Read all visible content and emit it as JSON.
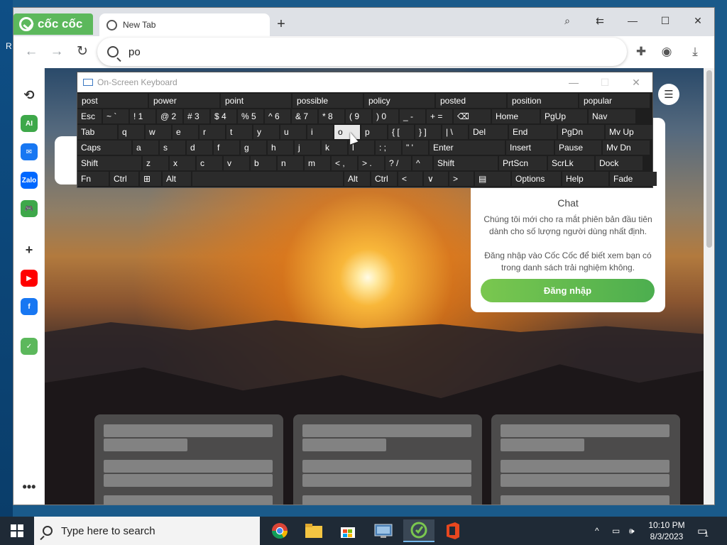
{
  "desktop": {
    "edge_text": "R"
  },
  "browser": {
    "brand": "cốc cốc",
    "tab_title": "New Tab",
    "new_tab": "+",
    "window_controls": {
      "minimize": "—",
      "maximize": "☐",
      "close": "✕"
    },
    "extra_controls": {
      "screenshot": "⌕",
      "sidebar_toggle": "⇇"
    },
    "nav": {
      "back": "←",
      "forward": "→",
      "reload": "↻"
    },
    "omnibox_value": "po",
    "toolbar_icons": {
      "extensions": "✚",
      "profile": "◉",
      "download": "⤓"
    }
  },
  "sidebar": [
    {
      "name": "history-icon",
      "glyph": "⟲",
      "color": "#333333"
    },
    {
      "name": "ai-icon",
      "glyph": "AI",
      "color": "#3ea84a"
    },
    {
      "name": "messenger-icon",
      "glyph": "✉",
      "color": "#1877f2"
    },
    {
      "name": "zalo-icon",
      "glyph": "Zalo",
      "color": "#0068ff"
    },
    {
      "name": "game-icon",
      "glyph": "🎮",
      "color": "#3ea84a"
    },
    {
      "name": "add-icon",
      "glyph": "+",
      "color": "#333333"
    },
    {
      "name": "youtube-icon",
      "glyph": "▶",
      "color": "#ff0000"
    },
    {
      "name": "facebook-icon",
      "glyph": "f",
      "color": "#1877f2"
    },
    {
      "name": "coccoc-icon",
      "glyph": "✓",
      "color": "#5cb85c"
    },
    {
      "name": "more-icon",
      "glyph": "•••",
      "color": "#333333"
    }
  ],
  "chat_card": {
    "title": "Chat",
    "text1": "Chúng tôi mới cho ra mắt phiên bản đầu tiên dành cho số lượng người dùng nhất định.",
    "text2": "Đăng nhập vào Cốc Cốc để biết xem bạn có trong danh sách trải nghiệm không.",
    "login_button": "Đăng nhập"
  },
  "settings_icon": "☰",
  "osk": {
    "title": "On-Screen Keyboard",
    "controls": {
      "minimize": "—",
      "maximize": "☐",
      "close": "✕"
    },
    "predictions": [
      "post",
      "power",
      "point",
      "possible",
      "policy",
      "posted",
      "position",
      "popular"
    ],
    "rows": [
      [
        "Esc",
        "~ `",
        "! 1",
        "@ 2",
        "# 3",
        "$ 4",
        "% 5",
        "^ 6",
        "& 7",
        "* 8",
        "( 9",
        ") 0",
        "_ -",
        "+ =",
        "⌫",
        "Home",
        "PgUp",
        "Nav"
      ],
      [
        "Tab",
        "q",
        "w",
        "e",
        "r",
        "t",
        "y",
        "u",
        "i",
        "o",
        "p",
        "{ [",
        "} ]",
        "| \\",
        "Del",
        "End",
        "PgDn",
        "Mv Up"
      ],
      [
        "Caps",
        "a",
        "s",
        "d",
        "f",
        "g",
        "h",
        "j",
        "k",
        "l",
        ": ;",
        "\" '",
        "Enter",
        "Insert",
        "Pause",
        "Mv Dn"
      ],
      [
        "Shift",
        "z",
        "x",
        "c",
        "v",
        "b",
        "n",
        "m",
        "< ,",
        "> .",
        "? /",
        "^",
        "Shift",
        "PrtScn",
        "ScrLk",
        "Dock"
      ],
      [
        "Fn",
        "Ctrl",
        "⊞",
        "Alt",
        "",
        "Alt",
        "Ctrl",
        "<",
        "∨",
        ">",
        "▤",
        "Options",
        "Help",
        "Fade"
      ]
    ]
  },
  "taskbar": {
    "search_placeholder": "Type here to search",
    "time": "10:10 PM",
    "date": "8/3/2023",
    "notification_count": "1",
    "tray_glyphs": {
      "chevron": "^",
      "network": "▭",
      "volume": "🕪"
    }
  }
}
